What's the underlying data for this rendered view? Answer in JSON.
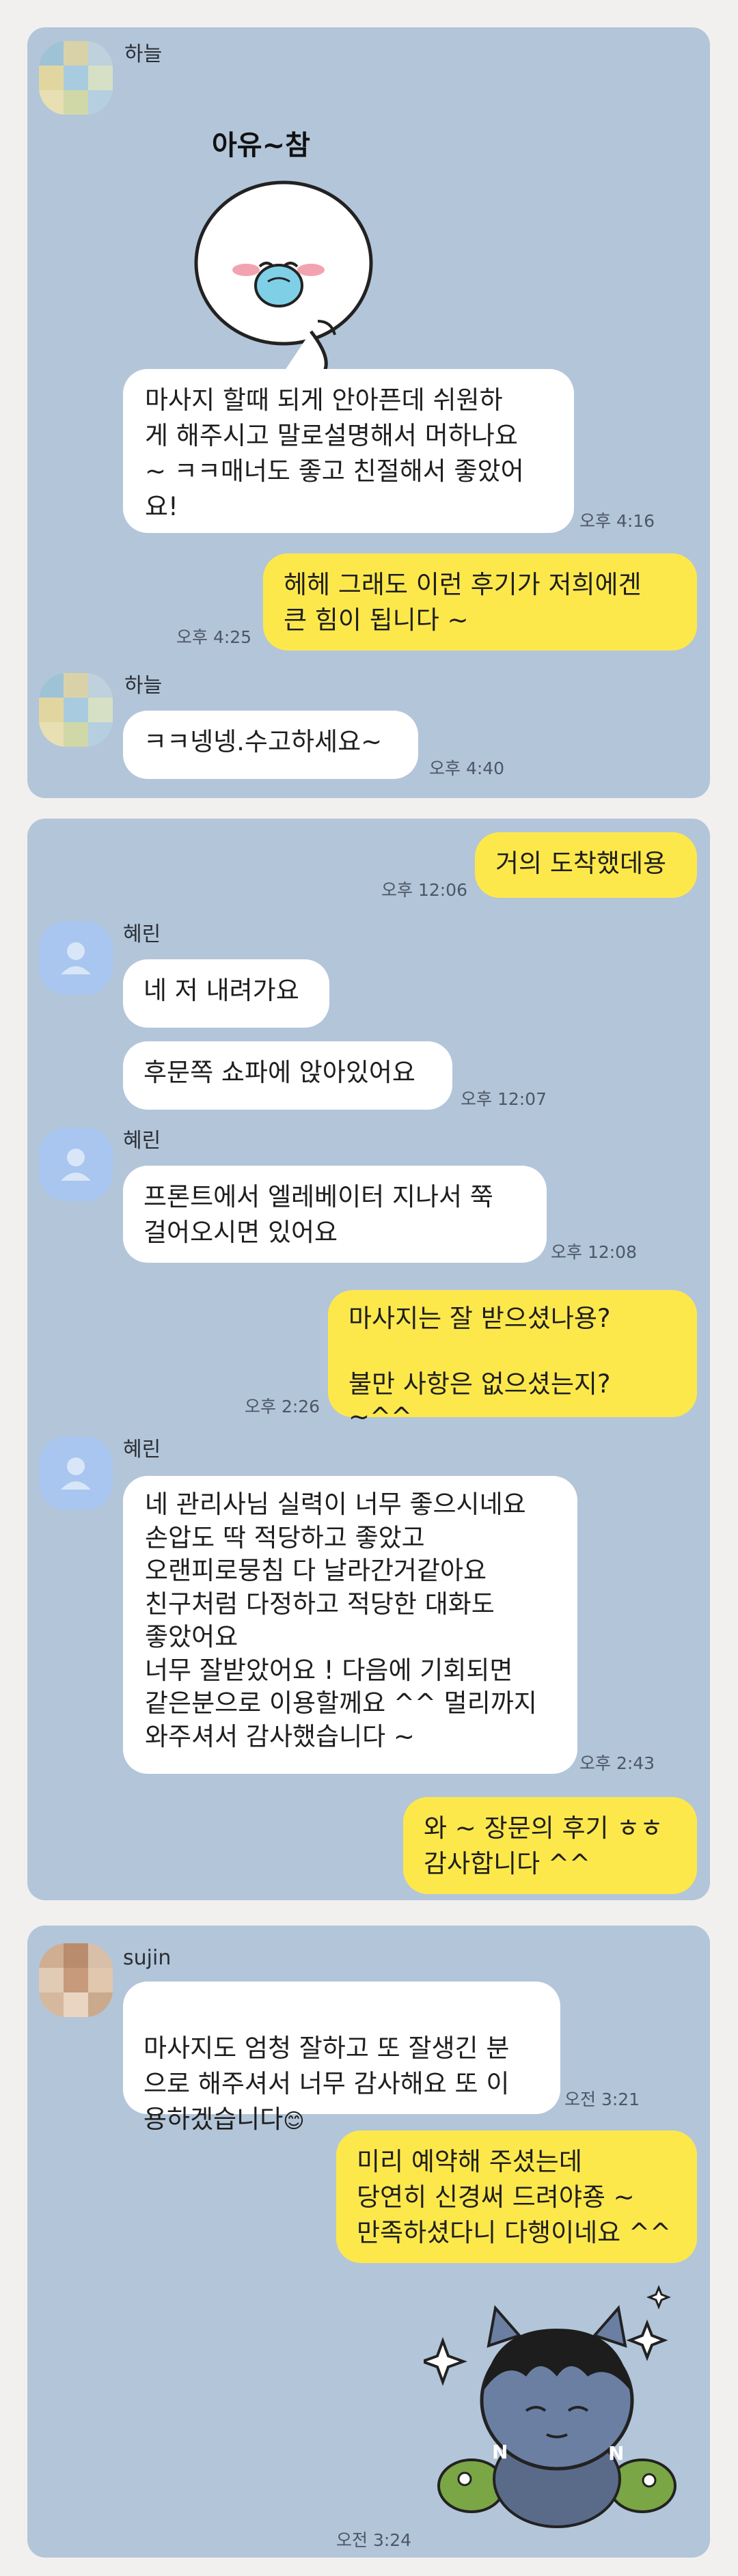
{
  "panels": [
    {
      "messages": [
        {
          "sender": "하늘"
        },
        {
          "sticker_caption": "아유~참"
        },
        {
          "text": "마사지 할때 되게 안아픈데 쉬원하\n게 해주시고 말로설명해서 머하나요\n~ ㅋㅋ매너도 좋고 친절해서 좋았어\n요!",
          "time": "오후 4:16"
        },
        {
          "text": "헤헤 그래도 이런 후기가 저희에겐\n큰 힘이 됩니다 ~",
          "time": "오후 4:25"
        },
        {
          "sender": "하늘"
        },
        {
          "text": "ㅋㅋ넹넹.수고하세요~",
          "time": "오후 4:40"
        }
      ]
    },
    {
      "messages": [
        {
          "text": "거의 도착했데용",
          "time": "오후 12:06"
        },
        {
          "sender": "혜린"
        },
        {
          "text": "네 저 내려가요"
        },
        {
          "text": "후문쪽 쇼파에 앉아있어요",
          "time": "오후 12:07"
        },
        {
          "sender": "혜린"
        },
        {
          "text": "프론트에서 엘레베이터 지나서 쭉\n걸어오시면 있어요",
          "time": "오후 12:08"
        },
        {
          "text": "마사지는 잘 받으셨나용?\n\n불만 사항은 없으셨는지? ~^^",
          "time": "오후 2:26"
        },
        {
          "sender": "혜린"
        },
        {
          "text": "네 관리사님 실력이 너무 좋으시네요\n손압도 딱 적당하고 좋았고\n오랜피로뭉침 다 날라간거같아요\n친구처럼 다정하고 적당한 대화도\n좋았어요\n너무 잘받았어요 ! 다음에 기회되면\n같은분으로 이용할께요 ^^ 멀리까지\n와주셔서 감사했습니다 ~",
          "time": "오후 2:43"
        },
        {
          "text": "와 ~ 장문의 후기 ㅎㅎ\n감사합니다 ^^"
        }
      ]
    },
    {
      "messages": [
        {
          "sender": "sujin"
        },
        {
          "text": "마사지도 엄청 잘하고 또 잘생긴 분\n으로 해주셔서 너무 감사해요 또 이\n용하겠습니다",
          "emoji": "😊",
          "time": "오전 3:21"
        },
        {
          "text": "미리 예약해 주셨는데\n당연히 신경써 드려야죵 ~\n만족하셨다니 다행이네요 ^^"
        },
        {
          "time": "오전 3:24"
        }
      ]
    }
  ],
  "colors": {
    "chat_bg": "#b3c5d9",
    "outgoing": "#fde84c",
    "incoming": "#ffffff",
    "page_bg": "#f2f0ee"
  }
}
